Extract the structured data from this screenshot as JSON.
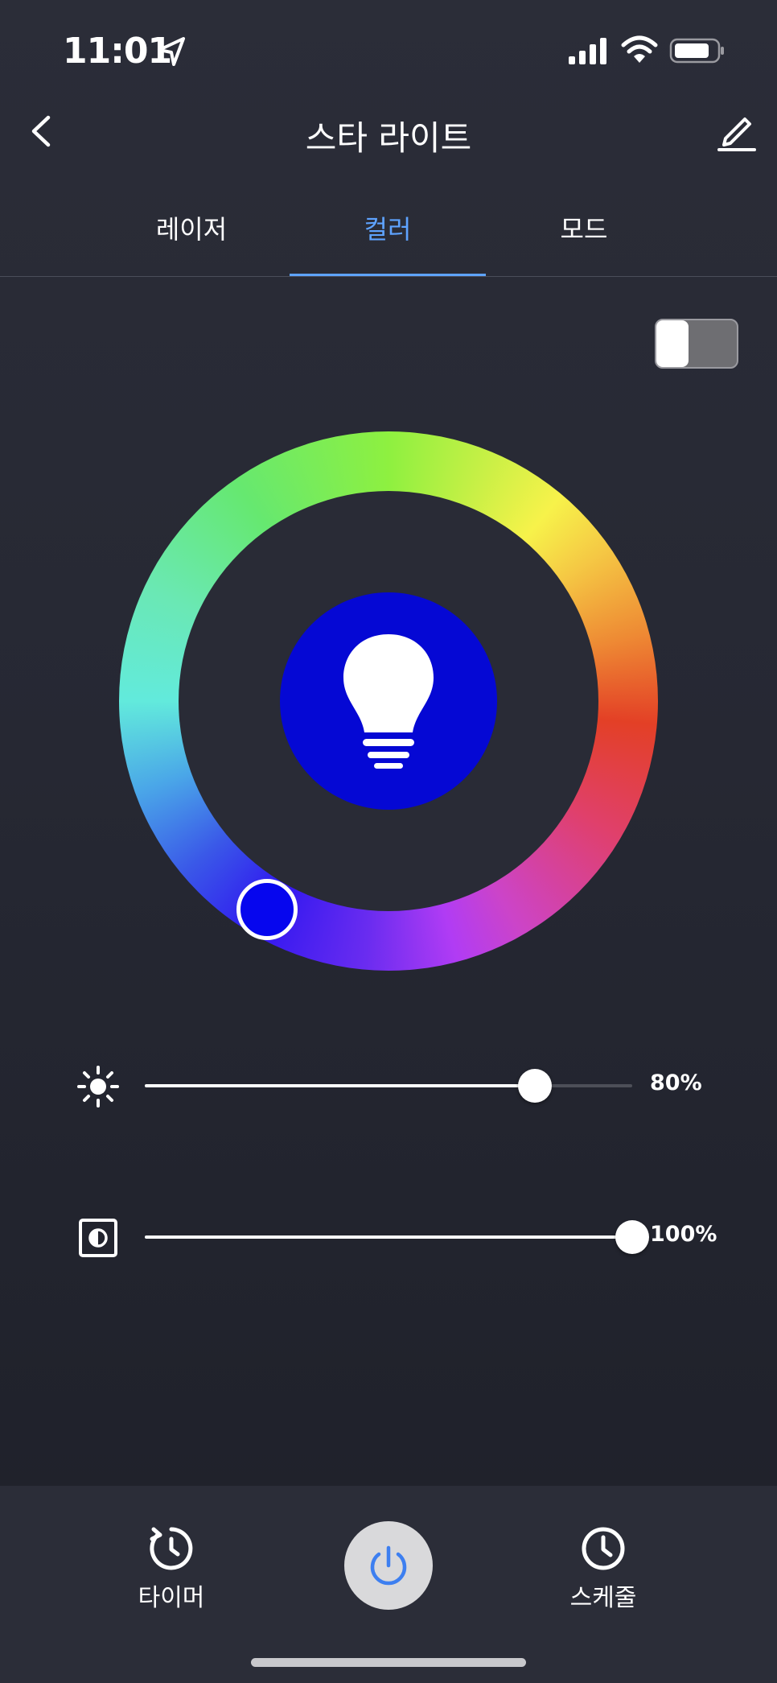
{
  "status_bar": {
    "time": "11:01",
    "icons": [
      "location-arrow-icon",
      "signal-icon",
      "wifi-icon",
      "battery-icon"
    ]
  },
  "header": {
    "title": "스타 라이트",
    "back_icon": "chevron-left-icon",
    "edit_icon": "pencil-icon"
  },
  "tabs": [
    {
      "label": "레이저",
      "active": false
    },
    {
      "label": "컬러",
      "active": true
    },
    {
      "label": "모드",
      "active": false
    }
  ],
  "toggle": {
    "on": false
  },
  "color_wheel": {
    "selected_color": "#0606ee",
    "center_icon": "light-bulb-icon"
  },
  "sliders": {
    "brightness": {
      "icon": "sun-icon",
      "value": 80,
      "label": "80%"
    },
    "contrast": {
      "icon": "contrast-icon",
      "value": 100,
      "label": "100%"
    }
  },
  "bottom_bar": {
    "timer_label": "타이머",
    "schedule_label": "스케줄",
    "power_icon": "power-icon"
  },
  "colors": {
    "accent": "#5ea3ff",
    "background": "#2b2d38",
    "bulb": "#0508d4"
  }
}
